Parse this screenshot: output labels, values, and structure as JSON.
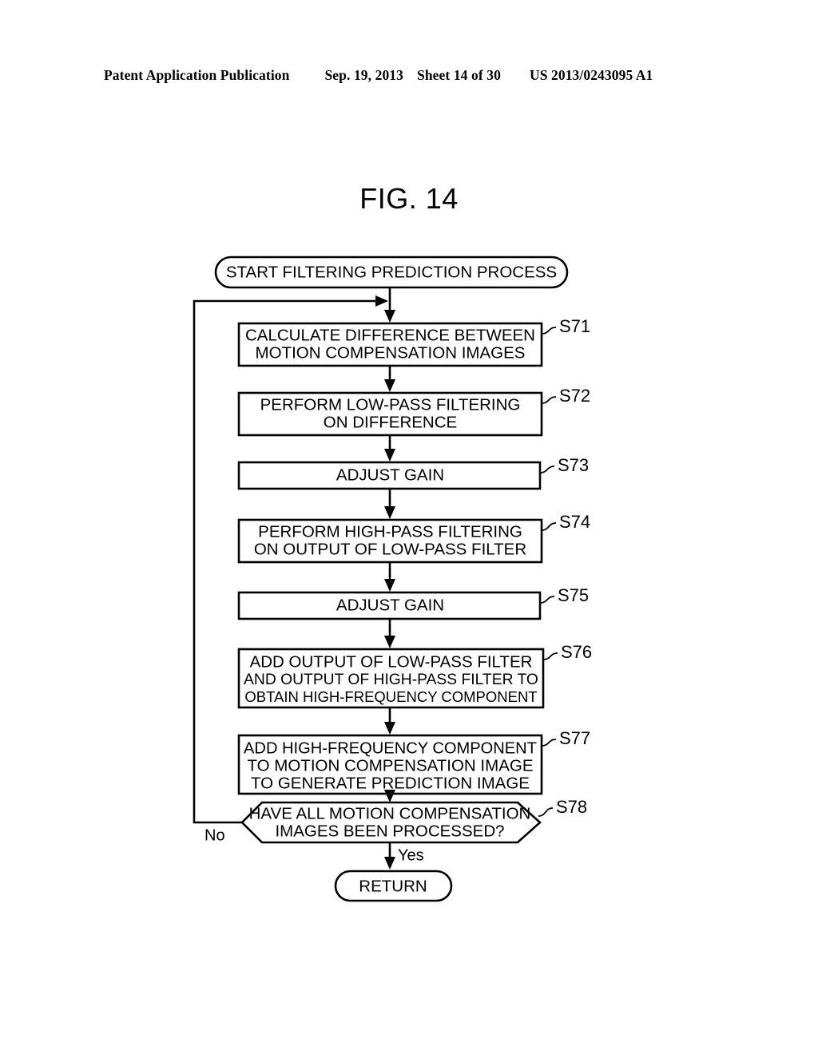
{
  "header": {
    "publication": "Patent Application Publication",
    "date": "Sep. 19, 2013",
    "sheet": "Sheet 14 of 30",
    "patent_number": "US 2013/0243095 A1"
  },
  "figure": {
    "title": "FIG. 14"
  },
  "flowchart": {
    "start": {
      "label": "START FILTERING PREDICTION PROCESS"
    },
    "end": {
      "label": "RETURN"
    },
    "branches": {
      "no": "No",
      "yes": "Yes"
    },
    "steps": [
      {
        "id": "S71",
        "lines": [
          "CALCULATE DIFFERENCE BETWEEN",
          "MOTION COMPENSATION IMAGES"
        ]
      },
      {
        "id": "S72",
        "lines": [
          "PERFORM LOW-PASS FILTERING",
          "ON DIFFERENCE"
        ]
      },
      {
        "id": "S73",
        "lines": [
          "ADJUST GAIN"
        ]
      },
      {
        "id": "S74",
        "lines": [
          "PERFORM HIGH-PASS FILTERING",
          "ON OUTPUT OF LOW-PASS FILTER"
        ]
      },
      {
        "id": "S75",
        "lines": [
          "ADJUST GAIN"
        ]
      },
      {
        "id": "S76",
        "lines": [
          "ADD OUTPUT OF LOW-PASS FILTER",
          "AND OUTPUT OF HIGH-PASS FILTER TO",
          "OBTAIN HIGH-FREQUENCY COMPONENT"
        ]
      },
      {
        "id": "S77",
        "lines": [
          "ADD HIGH-FREQUENCY COMPONENT",
          "TO MOTION COMPENSATION IMAGE",
          "TO GENERATE PREDICTION IMAGE"
        ]
      },
      {
        "id": "S78",
        "lines": [
          "HAVE ALL MOTION COMPENSATION",
          "IMAGES BEEN PROCESSED?"
        ]
      }
    ]
  },
  "colors": {
    "ink": "#000000",
    "paper": "#ffffff"
  }
}
